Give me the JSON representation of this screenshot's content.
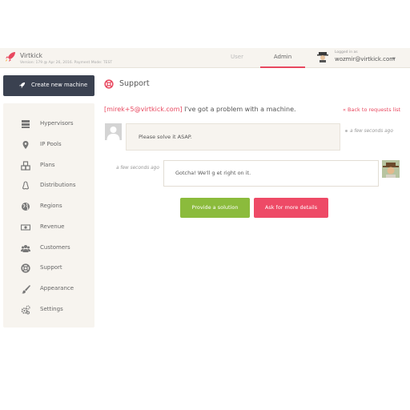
{
  "header": {
    "app_name": "Virtkick",
    "version_line": "Version: 179 @ Apr 26, 2016. Payment Mode: TEST",
    "tabs": [
      {
        "label": "User",
        "active": false
      },
      {
        "label": "Admin",
        "active": true
      }
    ],
    "logged_in_label": "Logged in as",
    "user_email": "wozmir@virtkick.com",
    "dropdown_glyph": "▼"
  },
  "sidebar": {
    "new_machine_label": "Create new machine",
    "items": [
      {
        "label": "Hypervisors",
        "icon": "server-icon"
      },
      {
        "label": "IP Pools",
        "icon": "map-marker-icon"
      },
      {
        "label": "Plans",
        "icon": "cubes-icon"
      },
      {
        "label": "Distributions",
        "icon": "linux-icon"
      },
      {
        "label": "Regions",
        "icon": "globe-icon"
      },
      {
        "label": "Revenue",
        "icon": "money-icon"
      },
      {
        "label": "Customers",
        "icon": "users-icon"
      },
      {
        "label": "Support",
        "icon": "life-ring-icon"
      },
      {
        "label": "Appearance",
        "icon": "brush-icon"
      },
      {
        "label": "Settings",
        "icon": "cogs-icon"
      }
    ]
  },
  "main": {
    "title": "Support",
    "request": {
      "author_email": "[mirek+5@virtkick.com]",
      "subject": " I've got a problem with a machine.",
      "back_link": "« Back to requests list"
    },
    "messages": [
      {
        "text": "Please solve it ASAP.",
        "time": "a few seconds ago",
        "side": "customer"
      },
      {
        "text": "Gotcha! We'll g et right on it.",
        "time": "a few seconds ago",
        "side": "admin"
      }
    ],
    "actions": {
      "provide_solution": "Provide a solution",
      "ask_details": "Ask for more details"
    }
  },
  "colors": {
    "accent": "#e8485f",
    "sidebar_bg": "#f7f4ef",
    "dark_button": "#3a4150",
    "green_button": "#8bbb3c",
    "red_button": "#ee4a66"
  }
}
